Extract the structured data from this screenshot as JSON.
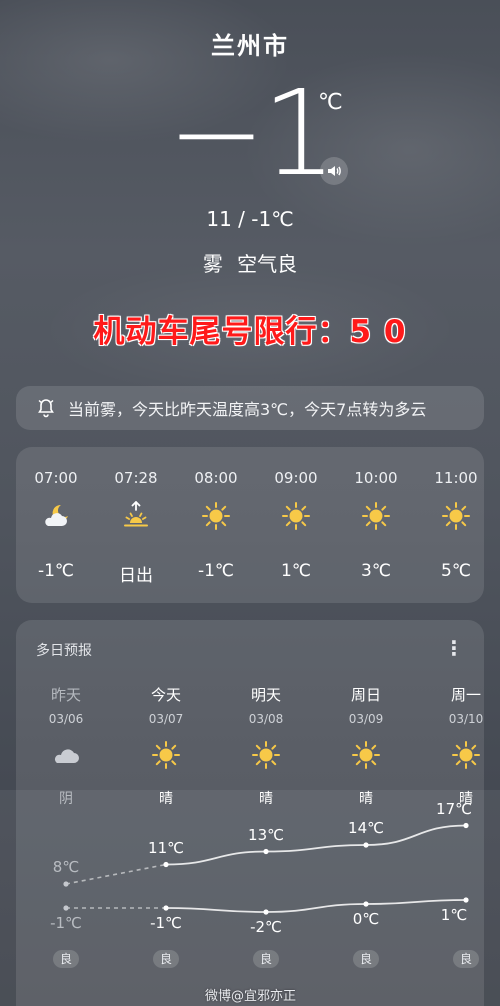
{
  "city": "兰州市",
  "current": {
    "temp": "−1",
    "unit": "℃",
    "range": "11 / -1℃",
    "condition": "雾",
    "air": "空气良"
  },
  "restriction": "机动车尾号限行：5  0",
  "alert": "当前雾，今天比昨天温度高3℃，今天7点转为多云",
  "hourly": [
    {
      "time": "07:00",
      "icon": "moon-cloud-icon",
      "value": "-1℃"
    },
    {
      "time": "07:28",
      "icon": "sunrise-icon",
      "value": "日出"
    },
    {
      "time": "08:00",
      "icon": "sun-icon",
      "value": "-1℃"
    },
    {
      "time": "09:00",
      "icon": "sun-icon",
      "value": "1℃"
    },
    {
      "time": "10:00",
      "icon": "sun-icon",
      "value": "3℃"
    },
    {
      "time": "11:00",
      "icon": "sun-icon",
      "value": "5℃"
    }
  ],
  "daily": {
    "title": "多日预报",
    "menu": "⋮",
    "days": [
      {
        "name": "昨天",
        "date": "03/06",
        "icon": "cloud-icon",
        "weather": "阴",
        "high": "8℃",
        "low": "-1℃",
        "aq": "良"
      },
      {
        "name": "今天",
        "date": "03/07",
        "icon": "sun-icon",
        "weather": "晴",
        "high": "11℃",
        "low": "-1℃",
        "aq": "良"
      },
      {
        "name": "明天",
        "date": "03/08",
        "icon": "sun-icon",
        "weather": "晴",
        "high": "13℃",
        "low": "-2℃",
        "aq": "良"
      },
      {
        "name": "周日",
        "date": "03/09",
        "icon": "sun-icon",
        "weather": "晴",
        "high": "14℃",
        "low": "0℃",
        "aq": "良"
      },
      {
        "name": "周一",
        "date": "03/10",
        "icon": "sun-icon",
        "weather": "晴",
        "high": "17℃",
        "low": "1℃",
        "aq": "良"
      }
    ]
  },
  "watermark": "微博@宜邪亦正",
  "colors": {
    "restriction": "#ff1a1a",
    "sun": "#f7c948",
    "background": "#50555e"
  }
}
